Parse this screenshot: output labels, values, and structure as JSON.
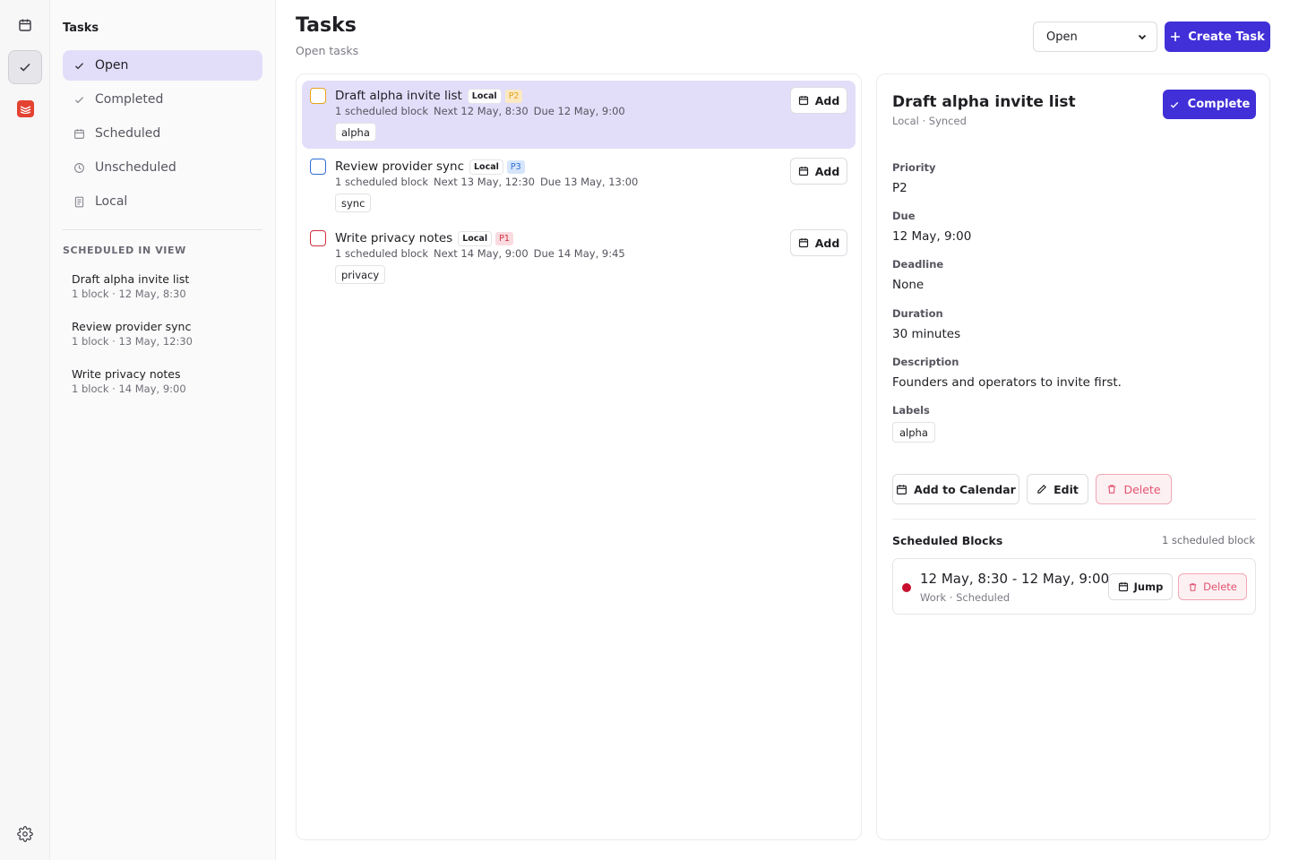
{
  "sidebar": {
    "title": "Tasks",
    "nav": [
      {
        "label": "Open",
        "icon": "check-icon",
        "active": true
      },
      {
        "label": "Completed",
        "icon": "check-icon"
      },
      {
        "label": "Scheduled",
        "icon": "calendar-icon"
      },
      {
        "label": "Unscheduled",
        "icon": "clock-icon"
      },
      {
        "label": "Local",
        "icon": "document-icon"
      }
    ],
    "scheduled_section": "SCHEDULED IN VIEW",
    "scheduled": [
      {
        "title": "Draft alpha invite list",
        "meta": "1 block · 12 May, 8:30"
      },
      {
        "title": "Review provider sync",
        "meta": "1 block · 13 May, 12:30"
      },
      {
        "title": "Write privacy notes",
        "meta": "1 block · 14 May, 9:00"
      }
    ]
  },
  "header": {
    "title": "Tasks",
    "subtitle": "Open tasks",
    "filter_value": "Open",
    "create_label": "Create Task"
  },
  "tasks": [
    {
      "title": "Draft alpha invite list",
      "source": "Local",
      "priority": "P2",
      "priority_color": "#e8a21b",
      "priority_bg": "#fbe9c4",
      "checkbox_color": "#e8a21b",
      "blocks": "1 scheduled block",
      "next": "Next 12 May, 8:30",
      "due": "Due 12 May, 9:00",
      "label": "alpha",
      "add_label": "Add",
      "selected": true
    },
    {
      "title": "Review provider sync",
      "source": "Local",
      "priority": "P3",
      "priority_color": "#2f6fd6",
      "priority_bg": "#d6e5fb",
      "checkbox_color": "#2f6fd6",
      "blocks": "1 scheduled block",
      "next": "Next 13 May, 12:30",
      "due": "Due 13 May, 13:00",
      "label": "sync",
      "add_label": "Add"
    },
    {
      "title": "Write privacy notes",
      "source": "Local",
      "priority": "P1",
      "priority_color": "#d0303f",
      "priority_bg": "#fadbe0",
      "checkbox_color": "#d0303f",
      "blocks": "1 scheduled block",
      "next": "Next 14 May, 9:00",
      "due": "Due 14 May, 9:45",
      "label": "privacy",
      "add_label": "Add"
    }
  ],
  "detail": {
    "title": "Draft alpha invite list",
    "subtitle": "Local · Synced",
    "complete_label": "Complete",
    "fields": {
      "priority_label": "Priority",
      "priority": "P2",
      "due_label": "Due",
      "due": "12 May, 9:00",
      "deadline_label": "Deadline",
      "deadline": "None",
      "duration_label": "Duration",
      "duration": "30 minutes",
      "description_label": "Description",
      "description": "Founders and operators to invite first.",
      "labels_label": "Labels",
      "label": "alpha"
    },
    "actions": {
      "add_calendar": "Add to Calendar",
      "edit": "Edit",
      "delete": "Delete"
    },
    "blocks_title": "Scheduled Blocks",
    "blocks_count": "1 scheduled block",
    "block": {
      "time": "12 May, 8:30 - 12 May, 9:00",
      "meta": "Work · Scheduled",
      "color": "#c8102e",
      "jump_label": "Jump",
      "delete_label": "Delete"
    }
  },
  "colors": {
    "accent": "#4130d8",
    "selected_bg": "#e2defa",
    "danger": "#e0536e"
  }
}
